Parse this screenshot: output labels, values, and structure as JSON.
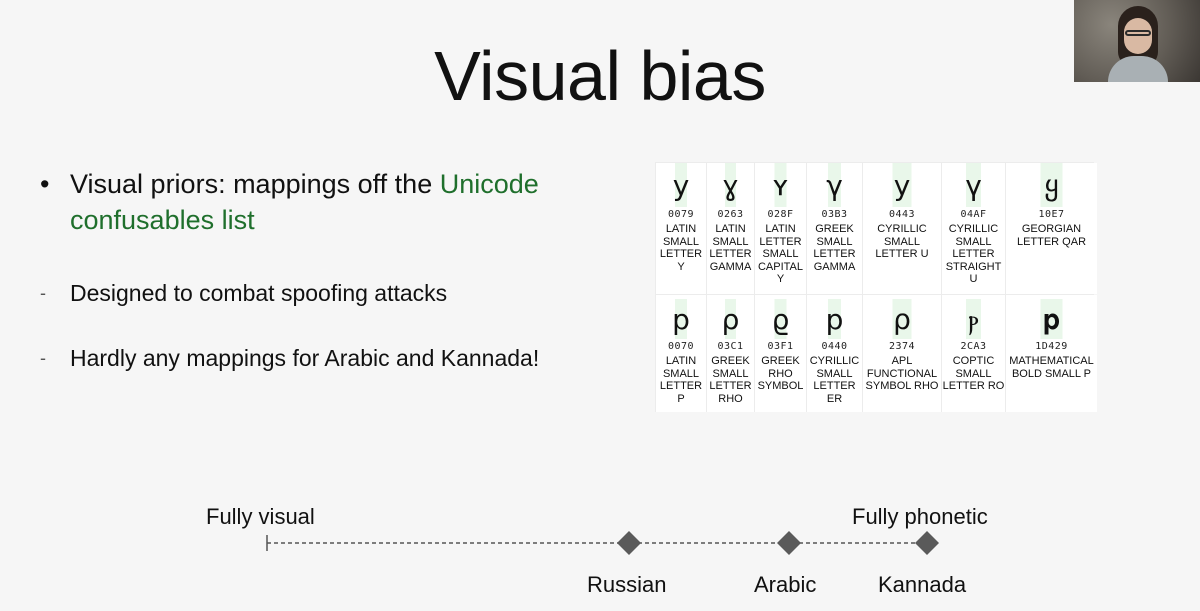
{
  "slide": {
    "title": "Visual bias",
    "bullet": {
      "prefix": "Visual priors: mappings off the ",
      "link": "Unicode confusables list"
    },
    "subpoints": [
      "Designed to combat spoofing attacks",
      "Hardly any mappings for Arabic and Kannada!"
    ],
    "bullet_symbol": "•",
    "dash_symbol": "-"
  },
  "confusables": {
    "rows": [
      [
        {
          "glyph": "y",
          "code": "0079",
          "name": "LATIN SMALL LETTER Y"
        },
        {
          "glyph": "ɣ",
          "code": "0263",
          "name": "LATIN SMALL LETTER GAMMA"
        },
        {
          "glyph": "ʏ",
          "code": "028F",
          "name": "LATIN LETTER SMALL CAPITAL Y"
        },
        {
          "glyph": "γ",
          "code": "03B3",
          "name": "GREEK SMALL LETTER GAMMA"
        },
        {
          "glyph": "у",
          "code": "0443",
          "name": "CYRILLIC SMALL LETTER U"
        },
        {
          "glyph": "ү",
          "code": "04AF",
          "name": "CYRILLIC SMALL LETTER STRAIGHT U"
        },
        {
          "glyph": "ყ",
          "code": "10E7",
          "name": "GEORGIAN LETTER QAR"
        }
      ],
      [
        {
          "glyph": "p",
          "code": "0070",
          "name": "LATIN SMALL LETTER P"
        },
        {
          "glyph": "ρ",
          "code": "03C1",
          "name": "GREEK SMALL LETTER RHO"
        },
        {
          "glyph": "ϱ",
          "code": "03F1",
          "name": "GREEK RHO SYMBOL"
        },
        {
          "glyph": "р",
          "code": "0440",
          "name": "CYRILLIC SMALL LETTER ER"
        },
        {
          "glyph": "⍴",
          "code": "2374",
          "name": "APL FUNCTIONAL SYMBOL RHO"
        },
        {
          "glyph": "ⲣ",
          "code": "2CA3",
          "name": "COPTIC SMALL LETTER RO"
        },
        {
          "glyph": "𝐩",
          "code": "1D429",
          "name": "MATHEMATICAL BOLD SMALL P"
        }
      ]
    ]
  },
  "scale": {
    "left_label": "Fully visual",
    "right_label": "Fully phonetic",
    "markers": [
      "Russian",
      "Arabic",
      "Kannada"
    ],
    "line_color": "#555555",
    "marker_color": "#5a5a5a"
  },
  "colors": {
    "background": "#f6f6f6",
    "link": "#1f6f2c"
  }
}
